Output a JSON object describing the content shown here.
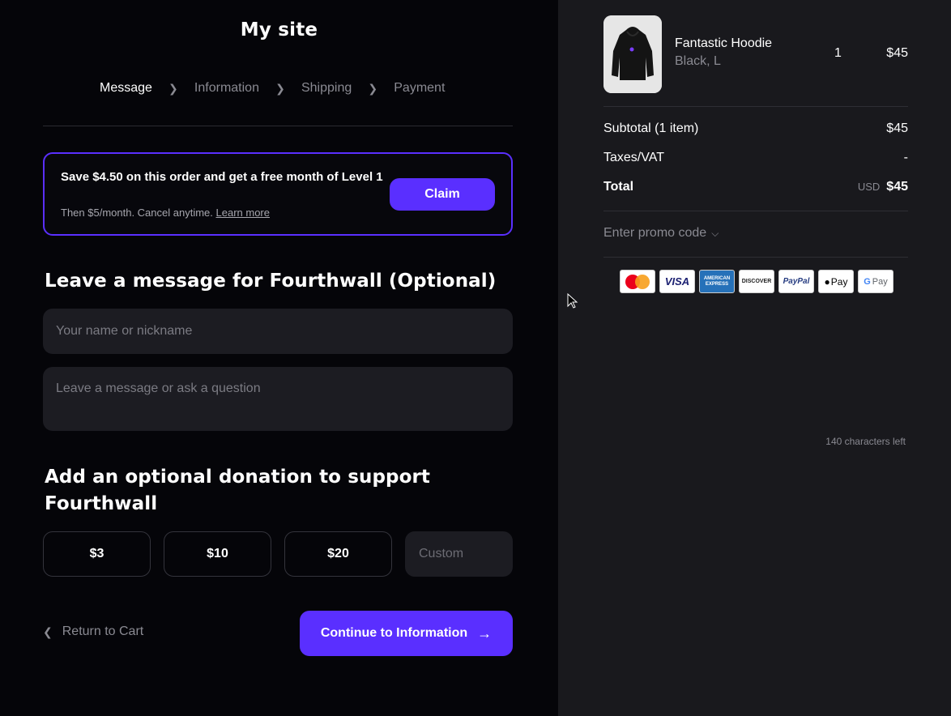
{
  "header": {
    "site_title": "My site"
  },
  "steps": [
    {
      "label": "Message",
      "active": true
    },
    {
      "label": "Information",
      "active": false
    },
    {
      "label": "Shipping",
      "active": false
    },
    {
      "label": "Payment",
      "active": false
    }
  ],
  "promo": {
    "title": "Save $4.50 on this order and get a free month of Level 1",
    "subtitle": "Then $5/month. Cancel anytime.",
    "link_label": "Learn more",
    "claim_label": "Claim"
  },
  "message_section": {
    "title": "Leave a message for Fourthwall (Optional)",
    "name_placeholder": "Your name or nickname",
    "message_placeholder": "Leave a message or ask a question",
    "chars_left": "140 characters left"
  },
  "donation_section": {
    "title": "Add an optional donation to support Fourthwall",
    "options": [
      "$3",
      "$10",
      "$20"
    ],
    "custom_placeholder": "Custom"
  },
  "footer": {
    "return_label": "Return to Cart",
    "continue_label": "Continue to Information"
  },
  "cart": {
    "item": {
      "name": "Fantastic Hoodie",
      "variant": "Black, L",
      "qty": "1",
      "price": "$45"
    },
    "subtotal_label": "Subtotal (1 item)",
    "subtotal_value": "$45",
    "taxes_label": "Taxes/VAT",
    "taxes_value": "-",
    "total_label": "Total",
    "currency": "USD",
    "total_value": "$45",
    "promo_toggle": "Enter promo code"
  },
  "payment_methods": {
    "visa": "VISA",
    "amex": "AMERICAN EXPRESS",
    "discover": "DISCOVER",
    "paypal": "PayPal",
    "applepay": "Pay",
    "gpay": "Pay"
  },
  "colors": {
    "accent": "#5a2fff",
    "left_bg": "#050509",
    "right_bg": "#19191d"
  }
}
